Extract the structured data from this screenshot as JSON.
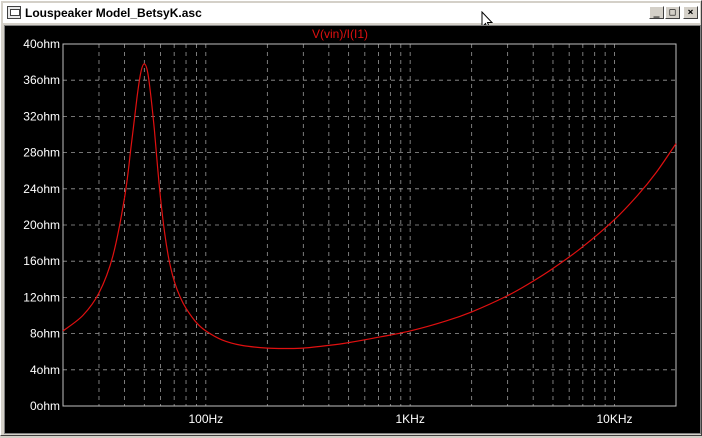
{
  "window": {
    "title": "Louspeaker Model_BetsyK.asc",
    "buttons": {
      "minimize": "_",
      "maximize": "□",
      "close": "×"
    }
  },
  "colors": {
    "trace": "#e01010",
    "grid": "#9a9a9a",
    "axis_text": "#ffffff",
    "background": "#000000"
  },
  "chart_data": {
    "type": "line",
    "title": "V(vin)/I(I1)",
    "x_scale": "log",
    "xlim": [
      20,
      20000
    ],
    "ylim": [
      0,
      40
    ],
    "x_ticks": [
      {
        "value": 100,
        "label": "100Hz"
      },
      {
        "value": 1000,
        "label": "1KHz"
      },
      {
        "value": 10000,
        "label": "10KHz"
      }
    ],
    "y_ticks": [
      {
        "value": 0,
        "label": "0ohm"
      },
      {
        "value": 4,
        "label": "4ohm"
      },
      {
        "value": 8,
        "label": "8ohm"
      },
      {
        "value": 12,
        "label": "12ohm"
      },
      {
        "value": 16,
        "label": "16ohm"
      },
      {
        "value": 20,
        "label": "20ohm"
      },
      {
        "value": 24,
        "label": "24ohm"
      },
      {
        "value": 28,
        "label": "28ohm"
      },
      {
        "value": 32,
        "label": "32ohm"
      },
      {
        "value": 36,
        "label": "36ohm"
      },
      {
        "value": 40,
        "label": "40ohm"
      }
    ],
    "grid": true,
    "series": [
      {
        "x": [
          20,
          25,
          30,
          35,
          40,
          43,
          46,
          48,
          50,
          52,
          54,
          56,
          58,
          60,
          63,
          66,
          70,
          75,
          80,
          90,
          100,
          120,
          150,
          200,
          250,
          300,
          400,
          500,
          700,
          1000,
          1500,
          2000,
          3000,
          4000,
          5000,
          7000,
          10000,
          13000,
          16000,
          20000
        ],
        "y": [
          8.3,
          10.0,
          12.5,
          16.5,
          23.0,
          28.5,
          34.0,
          36.8,
          37.8,
          36.8,
          34.0,
          30.5,
          26.5,
          23.0,
          19.0,
          16.2,
          13.8,
          12.0,
          10.8,
          9.2,
          8.3,
          7.3,
          6.7,
          6.4,
          6.35,
          6.4,
          6.7,
          7.0,
          7.6,
          8.3,
          9.4,
          10.4,
          12.2,
          13.8,
          15.2,
          17.6,
          20.6,
          23.3,
          25.8,
          29.0
        ]
      }
    ]
  }
}
